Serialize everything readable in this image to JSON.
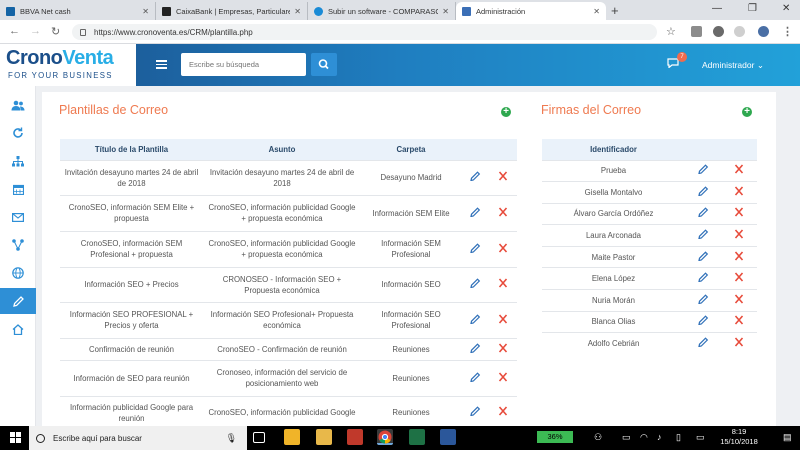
{
  "browser": {
    "tabs": [
      {
        "title": "BBVA Net cash",
        "favicon_color": "#1464a5"
      },
      {
        "title": "CaixaBank | Empresas, Particulare",
        "favicon_color": "#222222"
      },
      {
        "title": "Subir un software - COMPARASO",
        "favicon_color": "#1a8bd6"
      },
      {
        "title": "Administración",
        "favicon_color": "#3b6fb6"
      }
    ],
    "new_tab": "+",
    "url": "https://www.cronoventa.es/CRM/plantilla.php"
  },
  "app": {
    "logo_main_a": "Crono",
    "logo_main_b": "Venta",
    "logo_tagline": "FOR YOUR BUSINESS",
    "search_placeholder": "Escribe su búsqueda",
    "notification_count": "7",
    "user_menu": "Administrador",
    "brand_colors": {
      "header_start": "#1b4f8a",
      "header_end": "#22a1d9",
      "accent_orange": "#ef7a50",
      "add_green": "#2ea84f"
    }
  },
  "sidebar": {
    "items": [
      {
        "icon": "users-icon"
      },
      {
        "icon": "sync-icon"
      },
      {
        "icon": "sitemap-icon"
      },
      {
        "icon": "calendar-icon"
      },
      {
        "icon": "envelope-icon"
      },
      {
        "icon": "network-icon"
      },
      {
        "icon": "globe-icon"
      },
      {
        "icon": "pencil-icon",
        "active": true
      },
      {
        "icon": "home-icon"
      }
    ]
  },
  "plantillas": {
    "title": "Plantillas de Correo",
    "columns": [
      "Título de la Plantilla",
      "Asunto",
      "Carpeta"
    ],
    "rows": [
      {
        "titulo": "Invitación desayuno martes 24 de abril de 2018",
        "asunto": "Invitación desayuno martes 24 de abril de 2018",
        "carpeta": "Desayuno Madrid"
      },
      {
        "titulo": "CronoSEO, información SEM Elite + propuesta",
        "asunto": "CronoSEO, información publicidad Google + propuesta económica",
        "carpeta": "Información SEM Elite"
      },
      {
        "titulo": "CronoSEO, información SEM Profesional + propuesta",
        "asunto": "CronoSEO, información publicidad Google + propuesta económica",
        "carpeta": "Información SEM Profesional"
      },
      {
        "titulo": "Información SEO + Precios",
        "asunto": "CRONOSEO - Información SEO + Propuesta económica",
        "carpeta": "Información SEO"
      },
      {
        "titulo": "Información SEO PROFESIONAL + Precios y oferta",
        "asunto": "Información SEO Profesional+ Propuesta económica",
        "carpeta": "Información SEO Profesional"
      },
      {
        "titulo": "Confirmación de reunión",
        "asunto": "CronoSEO - Confirmación de reunión",
        "carpeta": "Reuniones"
      },
      {
        "titulo": "Información de SEO para reunión",
        "asunto": "Cronoseo, información del servicio de posicionamiento web",
        "carpeta": "Reuniones"
      },
      {
        "titulo": "Información publicidad Google para reunión",
        "asunto": "CronoSEO, información publicidad Google",
        "carpeta": "Reuniones"
      }
    ]
  },
  "firmas": {
    "title": "Firmas del Correo",
    "column": "Identificador",
    "rows": [
      "Prueba",
      "Gisella Montalvo",
      "Álvaro García Ordóñez",
      "Laura Arconada",
      "Maite Pastor",
      "Elena López",
      "Nuria Morán",
      "Blanca Olias",
      "Adolfo Cebrián"
    ]
  },
  "taskbar": {
    "search_text": "Escribe aquí para buscar",
    "battery": "36%",
    "time": "8:19",
    "date": "15/10/2018"
  }
}
